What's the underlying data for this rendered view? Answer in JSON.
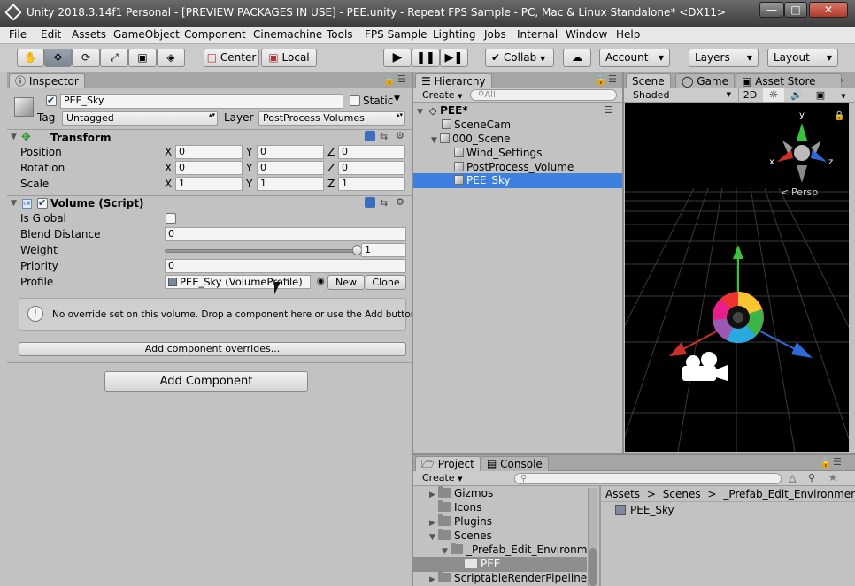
{
  "window": {
    "title": "Unity 2018.3.14f1 Personal - [PREVIEW PACKAGES IN USE] - PEE.unity - Repeat FPS Sample - PC, Mac & Linux Standalone* <DX11>",
    "minimize": "—",
    "maximize": "□",
    "close": "✕"
  },
  "menu": [
    "File",
    "Edit",
    "Assets",
    "GameObject",
    "Component",
    "Cinemachine",
    "Tools",
    "FPS Sample",
    "Lighting",
    "Jobs",
    "Internal",
    "Window",
    "Help"
  ],
  "toolbar": {
    "pivot": "Center",
    "space": "Local",
    "collab": "Collab",
    "account": "Account",
    "layers": "Layers",
    "layout": "Layout"
  },
  "inspector": {
    "tab": "Inspector",
    "object_name": "PEE_Sky",
    "static_label": "Static",
    "tag_label": "Tag",
    "tag_value": "Untagged",
    "layer_label": "Layer",
    "layer_value": "PostProcess Volumes",
    "transform": {
      "title": "Transform",
      "position_label": "Position",
      "rotation_label": "Rotation",
      "scale_label": "Scale",
      "axis_x": "X",
      "axis_y": "Y",
      "axis_z": "Z",
      "position": [
        "0",
        "0",
        "0"
      ],
      "rotation": [
        "0",
        "0",
        "0"
      ],
      "scale": [
        "1",
        "1",
        "1"
      ]
    },
    "volume": {
      "title": "Volume (Script)",
      "is_global_label": "Is Global",
      "blend_label": "Blend Distance",
      "blend_value": "0",
      "weight_label": "Weight",
      "weight_value": "1",
      "weight_fraction": 1,
      "priority_label": "Priority",
      "priority_value": "0",
      "profile_label": "Profile",
      "profile_value": "PEE_Sky (VolumeProfile)",
      "new_label": "New",
      "clone_label": "Clone",
      "help_text": "No override set on this volume. Drop a component here or use the Add button.",
      "add_overrides": "Add component overrides..."
    },
    "add_component": "Add Component"
  },
  "hierarchy": {
    "tab": "Hierarchy",
    "create": "Create",
    "search_placeholder": "All",
    "scene": "PEE*",
    "items": [
      "SceneCam",
      "000_Scene",
      "Wind_Settings",
      "PostProcess_Volume",
      "PEE_Sky"
    ]
  },
  "scene_view": {
    "tabs": [
      "Scene",
      "Game",
      "Asset Store"
    ],
    "shading": "Shaded",
    "mode_2d": "2D",
    "persp": "Persp",
    "gizmo_x": "x",
    "gizmo_y": "y",
    "gizmo_z": "z"
  },
  "project": {
    "tabs": [
      "Project",
      "Console"
    ],
    "create": "Create",
    "folders": [
      "Gizmos",
      "Icons",
      "Plugins",
      "Scenes",
      "_Prefab_Edit_Environm",
      "PEE",
      "ScriptableRenderPipeline"
    ],
    "breadcrumb": [
      "Assets",
      "Scenes",
      "_Prefab_Edit_Environment"
    ],
    "asset": "PEE_Sky"
  },
  "colors": {
    "selection": "#3d80df",
    "accent_blue": "#2d6ad8"
  }
}
